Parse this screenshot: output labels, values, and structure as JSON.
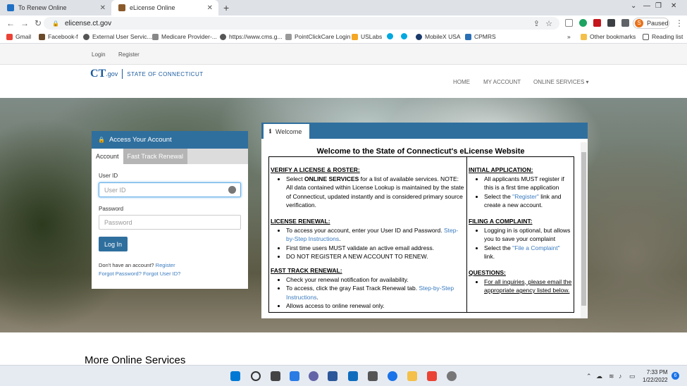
{
  "browser": {
    "tabs": [
      {
        "title": "To Renew Online",
        "active": false
      },
      {
        "title": "eLicense Online",
        "active": true
      }
    ],
    "url": "elicense.ct.gov",
    "profile_label": "Paused",
    "profile_initial": "S",
    "bookmarks": [
      "Gmail",
      "Facebook-f",
      "External User Servic...",
      "Medicare Provider-...",
      "https://www.cms.g...",
      "PointClickCare Login",
      "USLabs",
      "MobileX USA",
      "CPMRS"
    ],
    "bookmarks_more": "»",
    "other_bookmarks": "Other bookmarks",
    "reading_list": "Reading list"
  },
  "site": {
    "top_links": {
      "login": "Login",
      "register": "Register"
    },
    "logo": {
      "ct": "CT",
      "gov": ".gov",
      "state": "STATE OF CONNECTICUT"
    },
    "nav": {
      "home": "HOME",
      "account": "MY ACCOUNT",
      "services": "ONLINE SERVICES ▾"
    }
  },
  "login": {
    "header": "Access Your Account",
    "tab_account": "Account",
    "tab_fast": "Fast Track Renewal",
    "userid_label": "User ID",
    "userid_placeholder": "User ID",
    "password_label": "Password",
    "password_placeholder": "Password",
    "login_button": "Log In",
    "no_account": "Don't have an account?",
    "register_link": "Register",
    "forgot_password": "Forgot Password?",
    "forgot_userid": "Forgot User ID?"
  },
  "welcome": {
    "tab": "Welcome",
    "title": "Welcome to the State of Connecticut's eLicense Website",
    "verify": {
      "heading": "VERIFY A LICENSE & ROSTER:",
      "pre": "Select ",
      "bold": "ONLINE SERVICES",
      "post": " for a list of available services. NOTE: All data contained within License Lookup is maintained by the state of Connecticut, updated instantly and is considered primary source verification."
    },
    "renewal": {
      "heading": "LICENSE RENEWAL:",
      "item1": "To access your account, enter your User ID and Password. ",
      "item1_link": "Step-by-Step Instructions",
      "item1_end": ".",
      "item2": "First time users MUST validate an active email address.",
      "item3": "DO NOT REGISTER A NEW ACCOUNT TO RENEW."
    },
    "fast": {
      "heading": "FAST TRACK RENEWAL:",
      "item1": "Check your renewal notification for availability.",
      "item2": "To access, click the gray Fast Track Renewal tab. ",
      "item2_link": "Step-by-Step Instructions",
      "item2_end": ".",
      "item3": "Allows access to online renewal only."
    },
    "initial": {
      "heading": "INITIAL APPLICATION:",
      "item1": "All applicants MUST register if this is a first time application",
      "item2_pre": "Select the ",
      "item2_link": "\"Register\"",
      "item2_post": " link and create a new account."
    },
    "complaint": {
      "heading": "FILING A COMPLAINT:",
      "item1": "Logging in is optional, but allows you to save your complaint",
      "item2_pre": "Select the ",
      "item2_link": "\"File a Complaint\"",
      "item2_post": " link."
    },
    "questions": {
      "heading": "QUESTIONS:",
      "item1": "For all inquiries, please email the appropriate agency listed below."
    }
  },
  "more_services": "More Online Services",
  "taskbar": {
    "time": "7:33 PM",
    "date": "1/22/2022",
    "notifications": "6"
  },
  "colors": {
    "brand_blue": "#2f6f9e",
    "link_blue": "#3a7bbf"
  }
}
